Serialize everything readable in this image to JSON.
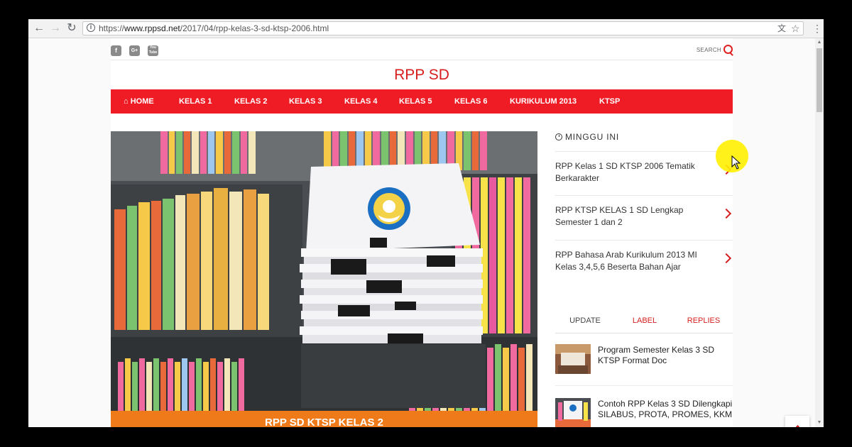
{
  "browser": {
    "url_scheme": "https://",
    "url_domain": "www.rppsd.net",
    "url_path": "/2017/04/rpp-kelas-3-sd-ktsp-2006.html",
    "back_icon": "back-arrow-icon",
    "forward_icon": "forward-arrow-icon",
    "reload_icon": "reload-icon"
  },
  "header": {
    "social": [
      "f",
      "G+",
      "You Tube"
    ],
    "search_label": "SEARCH"
  },
  "site": {
    "title": "RPP SD"
  },
  "menu": {
    "items": [
      "HOME",
      "KELAS 1",
      "KELAS 2",
      "KELAS 3",
      "KELAS 4",
      "KELAS 5",
      "KELAS 6",
      "KURIKULUM 2013",
      "KTSP"
    ],
    "home_icon": "home-icon"
  },
  "featured": {
    "caption": "RPP SD KTSP KELAS 2"
  },
  "sidebar": {
    "popular_title": "MINGGU INI",
    "popular": [
      "RPP Kelas 1 SD KTSP 2006 Tematik Berkarakter",
      "RPP KTSP KELAS 1 SD Lengkap Semester 1 dan 2",
      "RPP Bahasa Arab Kurikulum 2013 MI Kelas 3,4,5,6 Beserta Bahan Ajar"
    ],
    "tabs": [
      "UPDATE",
      "LABEL",
      "REPLIES"
    ],
    "active_tab": "UPDATE",
    "updates": [
      "Program Semester Kelas 3 SD KTSP Format Doc",
      "Contoh RPP Kelas 3 SD Dilengkapi SILABUS, PROTA, PROMES, KKM"
    ]
  },
  "colors": {
    "brand_red": "#ef1c25",
    "accent_orange": "#ef7a1a"
  }
}
